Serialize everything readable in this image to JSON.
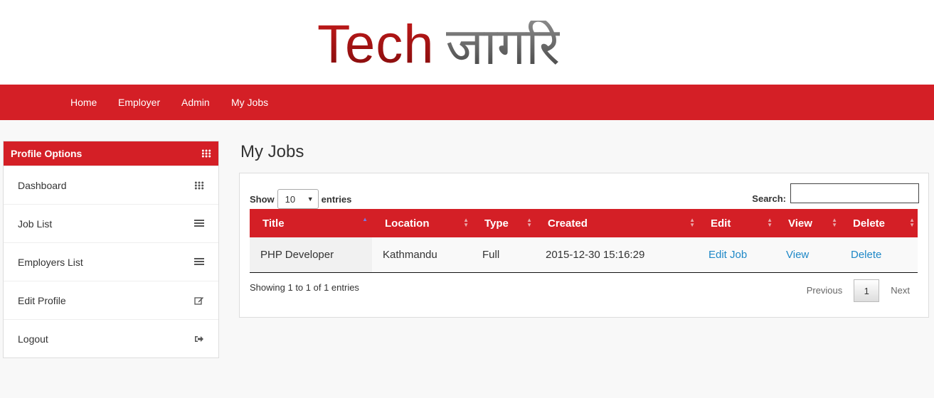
{
  "logo": {
    "latin": "Tech",
    "devanagari": "जागरि"
  },
  "nav": {
    "items": [
      "Home",
      "Employer",
      "Admin",
      "My Jobs"
    ]
  },
  "sidebar": {
    "title": "Profile Options",
    "items": [
      {
        "label": "Dashboard",
        "icon": "grid-icon"
      },
      {
        "label": "Job List",
        "icon": "list-icon"
      },
      {
        "label": "Employers List",
        "icon": "list-icon"
      },
      {
        "label": "Edit Profile",
        "icon": "edit-icon"
      },
      {
        "label": "Logout",
        "icon": "logout-icon"
      }
    ]
  },
  "main": {
    "title": "My Jobs",
    "length": {
      "show": "Show",
      "value": "10",
      "entries": "entries"
    },
    "search": {
      "label": "Search:",
      "value": ""
    },
    "columns": [
      "Title",
      "Location",
      "Type",
      "Created",
      "Edit",
      "View",
      "Delete"
    ],
    "rows": [
      {
        "title": "PHP Developer",
        "location": "Kathmandu",
        "type": "Full",
        "created": "2015-12-30 15:16:29",
        "edit": "Edit Job",
        "view": "View",
        "delete": "Delete"
      }
    ],
    "info": "Showing 1 to 1 of 1 entries",
    "pager": {
      "previous": "Previous",
      "current": "1",
      "next": "Next"
    }
  },
  "colors": {
    "brand": "#d41f26",
    "link": "#1e88c7"
  }
}
